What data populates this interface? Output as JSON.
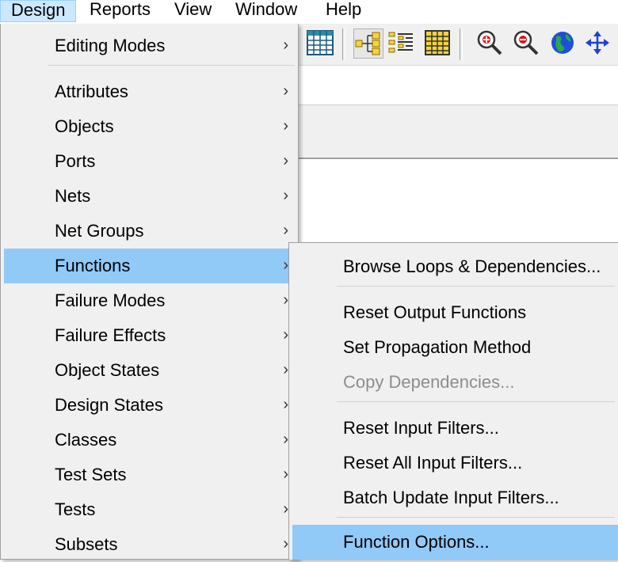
{
  "menubar": {
    "items": [
      {
        "label": "Design"
      },
      {
        "label": "Reports"
      },
      {
        "label": "View"
      },
      {
        "label": "Window"
      },
      {
        "label": "Help"
      }
    ]
  },
  "design_menu": {
    "items": [
      {
        "label": "Editing Modes",
        "arrow": "›"
      },
      {
        "label": "Attributes",
        "arrow": "›"
      },
      {
        "label": "Objects",
        "arrow": "›"
      },
      {
        "label": "Ports",
        "arrow": "›"
      },
      {
        "label": "Nets",
        "arrow": "›"
      },
      {
        "label": "Net Groups",
        "arrow": "›"
      },
      {
        "label": "Functions",
        "arrow": "›"
      },
      {
        "label": "Failure Modes",
        "arrow": "›"
      },
      {
        "label": "Failure Effects",
        "arrow": "›"
      },
      {
        "label": "Object States",
        "arrow": "›"
      },
      {
        "label": "Design States",
        "arrow": "›"
      },
      {
        "label": "Classes",
        "arrow": "›"
      },
      {
        "label": "Test Sets",
        "arrow": "›"
      },
      {
        "label": "Tests",
        "arrow": "›"
      },
      {
        "label": "Subsets",
        "arrow": "›"
      }
    ],
    "highlighted": "Functions"
  },
  "functions_submenu": {
    "items": [
      {
        "label": "Browse Loops & Dependencies..."
      },
      {
        "label": "Reset Output Functions"
      },
      {
        "label": "Set Propagation Method"
      },
      {
        "label": "Copy Dependencies...",
        "disabled": true
      },
      {
        "label": "Reset Input Filters..."
      },
      {
        "label": "Reset All Input Filters..."
      },
      {
        "label": "Batch Update Input Filters..."
      },
      {
        "label": "Function Options..."
      }
    ],
    "highlighted": "Function Options..."
  },
  "toolbar": {
    "icons": [
      "table-icon",
      "hierarchy-tree-icon",
      "list-tree-icon",
      "grid-table-icon",
      "zoom-in-icon",
      "zoom-out-icon",
      "globe-icon",
      "pan-arrows-icon"
    ]
  },
  "colors": {
    "menu_bg": "#f0f0f0",
    "highlight": "#91c9f7",
    "disabled_text": "#8d8d8d",
    "menubar_active": "#cce8ff"
  }
}
